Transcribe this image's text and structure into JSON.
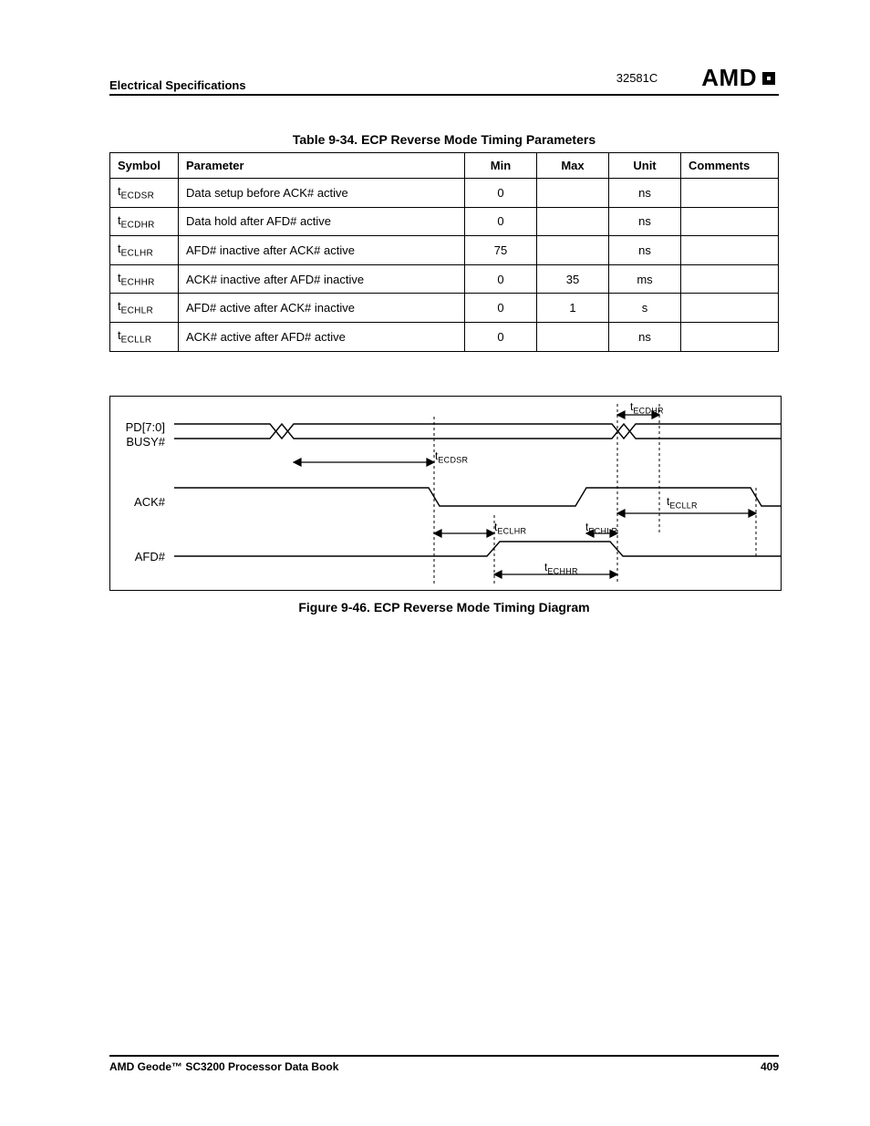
{
  "header": {
    "section": "Electrical Specifications",
    "doc_num": "32581C",
    "logo_text": "AMD"
  },
  "table": {
    "title": "Table 9-34.  ECP Reverse Mode Timing Parameters",
    "headers": {
      "symbol": "Symbol",
      "parameter": "Parameter",
      "min": "Min",
      "max": "Max",
      "unit": "Unit",
      "comments": "Comments"
    },
    "rows": [
      {
        "sym_sub": "ECDSR",
        "param": "Data setup before ACK# active",
        "min": "0",
        "max": "",
        "unit": "ns",
        "comments": ""
      },
      {
        "sym_sub": "ECDHR",
        "param": "Data hold after AFD# active",
        "min": "0",
        "max": "",
        "unit": "ns",
        "comments": ""
      },
      {
        "sym_sub": "ECLHR",
        "param": "AFD# inactive after ACK# active",
        "min": "75",
        "max": "",
        "unit": "ns",
        "comments": ""
      },
      {
        "sym_sub": "ECHHR",
        "param": "ACK# inactive after AFD# inactive",
        "min": "0",
        "max": "35",
        "unit": "ms",
        "comments": ""
      },
      {
        "sym_sub": "ECHLR",
        "param": "AFD# active after ACK# inactive",
        "min": "0",
        "max": "1",
        "unit": "s",
        "comments": ""
      },
      {
        "sym_sub": "ECLLR",
        "param": "ACK# active after AFD# active",
        "min": "0",
        "max": "",
        "unit": "ns",
        "comments": ""
      }
    ]
  },
  "figure": {
    "caption": "Figure 9-46.  ECP Reverse Mode Timing Diagram",
    "signals": {
      "pd": "PD[7:0]",
      "busy": "BUSY#",
      "ack": "ACK#",
      "afd": "AFD#"
    },
    "labels": {
      "ecdhr": "ECDHR",
      "ecdsr": "ECDSR",
      "ecllr": "ECLLR",
      "eclhr": "ECLHR",
      "echlr": "ECHLR",
      "echhr": "ECHHR"
    },
    "t_prefix": "t"
  },
  "footer": {
    "left": "AMD Geode™ SC3200 Processor Data Book",
    "right": "409"
  }
}
